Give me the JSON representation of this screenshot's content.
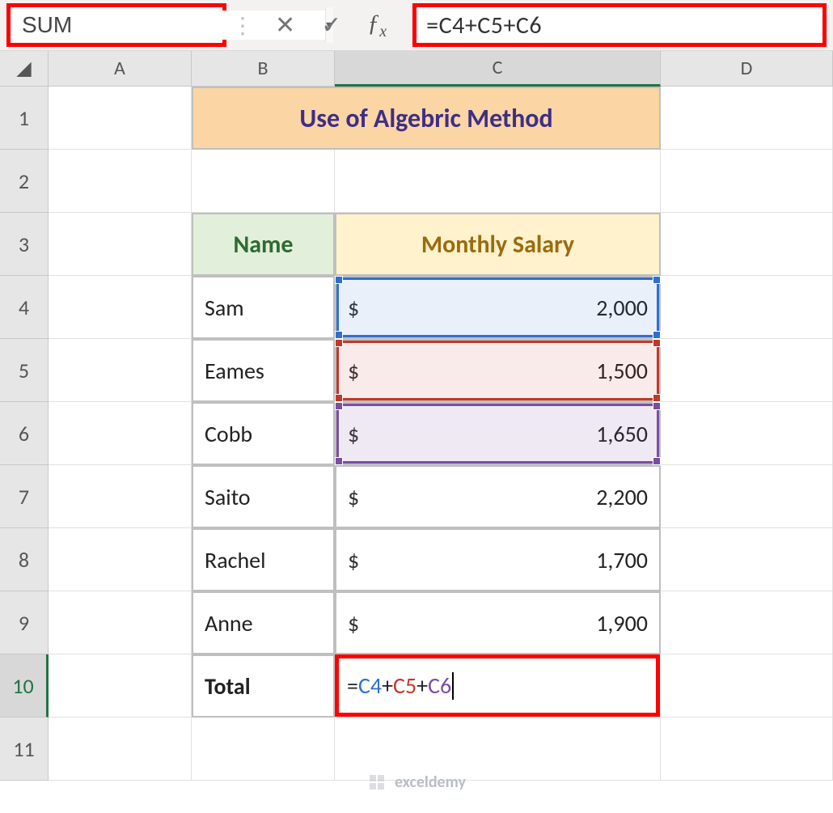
{
  "formula_bar": {
    "name_box": "SUM",
    "buttons": {
      "cancel": "✕",
      "enter": "✓",
      "fx": "fx"
    },
    "formula": "=C4+C5+C6"
  },
  "columns": [
    "A",
    "B",
    "C",
    "D"
  ],
  "rows": [
    "1",
    "2",
    "3",
    "4",
    "5",
    "6",
    "7",
    "8",
    "9",
    "10",
    "11"
  ],
  "title": "Use of Algebric Method",
  "headers": {
    "name": "Name",
    "salary": "Monthly Salary"
  },
  "currency": "$",
  "people": [
    {
      "name": "Sam",
      "salary": "2,000"
    },
    {
      "name": "Eames",
      "salary": "1,500"
    },
    {
      "name": "Cobb",
      "salary": "1,650"
    },
    {
      "name": "Saito",
      "salary": "2,200"
    },
    {
      "name": "Rachel",
      "salary": "1,700"
    },
    {
      "name": "Anne",
      "salary": "1,900"
    }
  ],
  "total_label": "Total",
  "total_formula": {
    "prefix": "=",
    "r1": "C4",
    "r2": "C5",
    "r3": "C6",
    "op": "+"
  },
  "watermark": "exceldemy"
}
